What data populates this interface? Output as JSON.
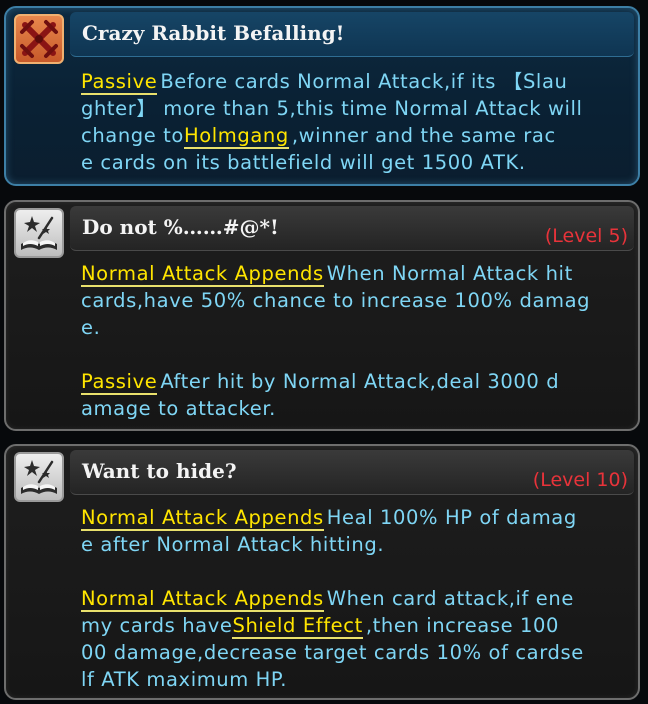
{
  "skills": [
    {
      "title": "Crazy Rabbit Befalling!",
      "icon": "crossed-swords-icon",
      "level": "",
      "lines": [
        {
          "kw": "Passive",
          "text": "Before cards Normal Attack,if its 【Slau"
        },
        {
          "kw": "",
          "text": "ghter】 more than 5,this time Normal Attack will"
        },
        {
          "pre": "change to",
          "kw": "Holmgang",
          "text": ",winner and the same rac"
        },
        {
          "kw": "",
          "text": "e cards on its battlefield will get 1500 ATK."
        }
      ]
    },
    {
      "title": "Do not %……#@*!",
      "icon": "magic-book-icon",
      "level": "(Level 5)",
      "lines": [
        {
          "kw": "Normal Attack Appends",
          "text": "When Normal Attack hit"
        },
        {
          "kw": "",
          "text": "cards,have 50% chance to increase 100% damag"
        },
        {
          "kw": "",
          "text": "e."
        },
        {
          "kw": "",
          "text": ""
        },
        {
          "kw": "Passive",
          "text": "After hit by Normal Attack,deal 3000 d"
        },
        {
          "kw": "",
          "text": "amage to attacker."
        }
      ]
    },
    {
      "title": "Want to hide?",
      "icon": "magic-book-icon",
      "level": "(Level 10)",
      "lines": [
        {
          "kw": "Normal Attack Appends",
          "text": "Heal 100% HP of damag"
        },
        {
          "kw": "",
          "text": "e after Normal Attack hitting."
        },
        {
          "kw": "",
          "text": ""
        },
        {
          "kw": "Normal Attack Appends",
          "text": "When card attack,if ene"
        },
        {
          "pre": "my cards have",
          "kw": "Shield Effect",
          "text": ",then increase 100"
        },
        {
          "kw": "",
          "text": "00 damage,decrease target cards 10% of cardse"
        },
        {
          "kw": "",
          "text": "lf ATK maximum HP."
        }
      ]
    }
  ],
  "colors": {
    "keyword": "#ffe500",
    "description": "#7fd6f5",
    "level": "#e8333a",
    "title": "#f4f4f4"
  }
}
